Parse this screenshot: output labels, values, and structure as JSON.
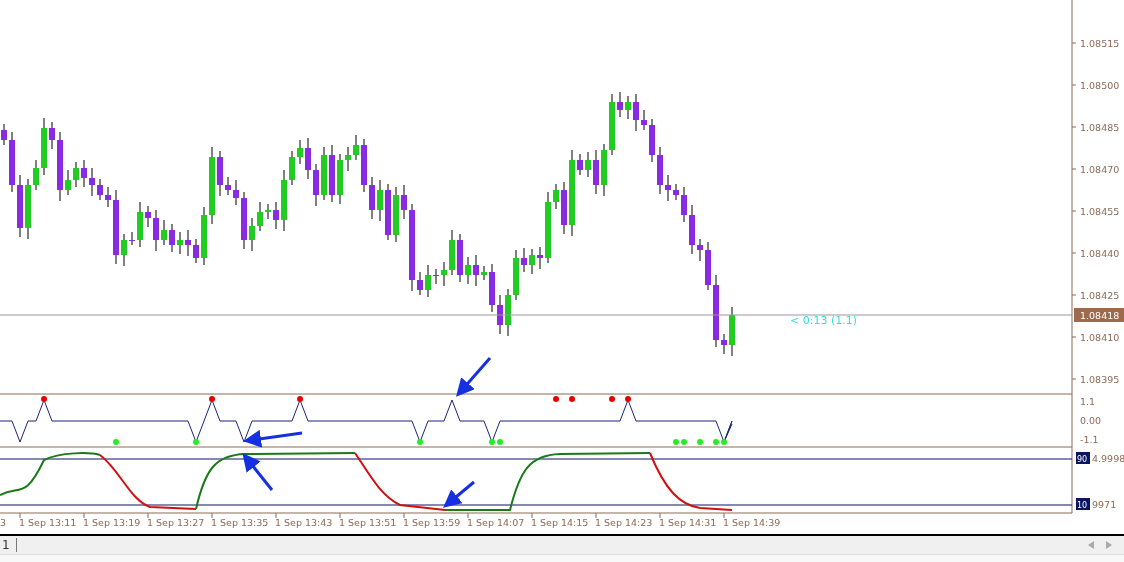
{
  "main_pane": {
    "price_labels": [
      "1.08515",
      "1.08500",
      "1.08485",
      "1.08470",
      "1.08455",
      "1.08440",
      "1.08425",
      "1.08410",
      "1.08395"
    ],
    "current_price": "1.08418",
    "timer": "< 0:13 (1.1)"
  },
  "signal_pane": {
    "axis_labels": [
      "1.1",
      "0.00",
      "-1.1"
    ]
  },
  "oscillator_pane": {
    "levels": [
      {
        "marker": "90",
        "value": "4.9998"
      },
      {
        "marker": "10",
        "value": "9971"
      }
    ]
  },
  "time_axis": {
    "labels": [
      "3",
      "1 Sep 13:11",
      "1 Sep 13:19",
      "1 Sep 13:27",
      "1 Sep 13:35",
      "1 Sep 13:43",
      "1 Sep 13:51",
      "1 Sep 13:59",
      "1 Sep 14:07",
      "1 Sep 14:15",
      "1 Sep 14:23",
      "1 Sep 14:31",
      "1 Sep 14:39"
    ]
  },
  "status_bar": {
    "tab": "1"
  }
}
